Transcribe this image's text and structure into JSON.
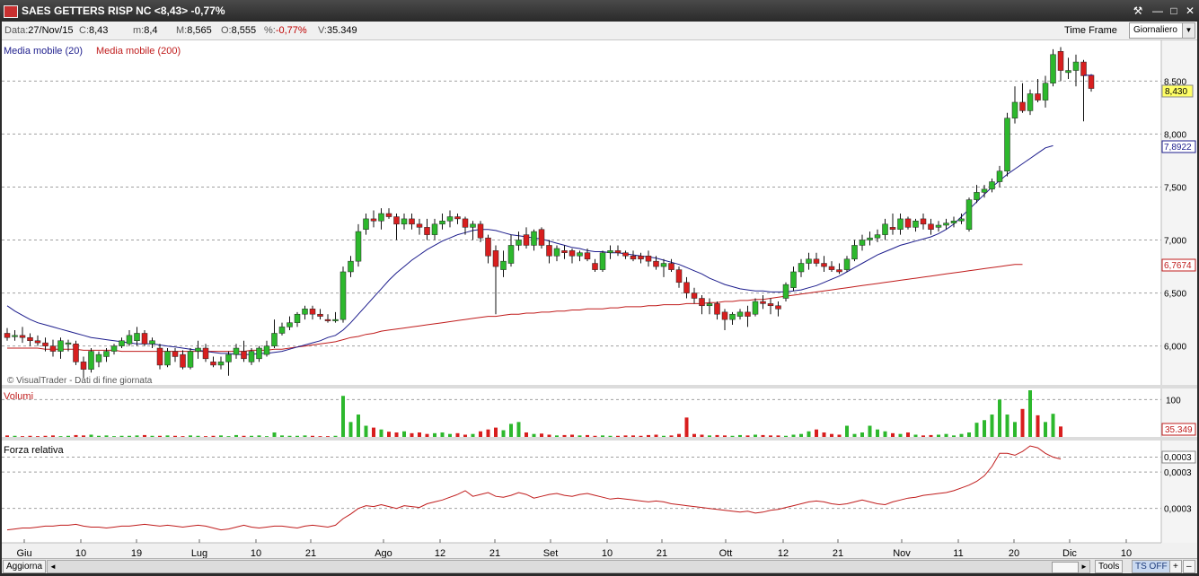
{
  "window": {
    "title": "SAES GETTERS RISP NC <8,43> -0,77%",
    "buttons": [
      "⚒",
      "―",
      "□",
      "✕"
    ]
  },
  "info": {
    "data_label": "Data:",
    "data_value": "27/Nov/15",
    "close_label": "C:",
    "close_value": "8,43",
    "min_label": "m:",
    "min_value": "8,4",
    "max_label": "M:",
    "max_value": "8,565",
    "open_label": "O:",
    "open_value": "8,555",
    "pct_label": "%:",
    "pct_value": "-0,77%",
    "vol_label": "V:",
    "vol_value": "35.349",
    "time_frame_label": "Time Frame",
    "time_frame_value": "Giornaliero"
  },
  "bottom": {
    "refresh_label": "Aggiorna",
    "scroll_left": "◄",
    "scroll_right": "►",
    "tools_label": "Tools",
    "ts_off_label": "TS OFF",
    "plus": "+",
    "minus": "–"
  },
  "colors": {
    "up": "#2db82d",
    "down": "#d81e1e",
    "ma20": "#1c1c8c",
    "ma200": "#c01c1c",
    "grid": "#a0a0a0"
  },
  "chart_data": {
    "type": "candlestick",
    "legend": [
      "Media mobile (20)",
      "Media mobile (200)"
    ],
    "copyright": "© VisualTrader - Dati di fine giornata",
    "volume_label": "Volumi",
    "rs_label": "Forza relativa",
    "x_labels": [
      "Giu",
      "10",
      "19",
      "Lug",
      "10",
      "21",
      "Ago",
      "12",
      "21",
      "Set",
      "10",
      "21",
      "Ott",
      "12",
      "21",
      "Nov",
      "11",
      "20",
      "Dic",
      "10"
    ],
    "price_axis": {
      "ticks": [
        6.0,
        6.5,
        7.0,
        7.5,
        8.0,
        8.5
      ],
      "tick_labels": [
        "6,000",
        "6,500",
        "7,000",
        "7,500",
        "8,000",
        "8,500"
      ],
      "ylim": [
        5.65,
        8.85
      ]
    },
    "price_tags": {
      "last": "8,430",
      "ma20": "7,8922",
      "ma200": "6,7674"
    },
    "volume_axis": {
      "ticks": [
        100
      ],
      "tick_labels": [
        "100"
      ],
      "last_label": "35.349",
      "ylim": [
        0,
        125
      ]
    },
    "rs_axis": {
      "tick_labels": [
        "0,0003",
        "0,0003",
        "0,0003"
      ],
      "last_label": "0,0003"
    },
    "ohlc": [
      [
        6.12,
        6.17,
        6.05,
        6.08
      ],
      [
        6.1,
        6.15,
        6.05,
        6.1
      ],
      [
        6.1,
        6.18,
        6.03,
        6.08
      ],
      [
        6.08,
        6.12,
        6.0,
        6.05
      ],
      [
        6.05,
        6.1,
        6.0,
        6.03
      ],
      [
        6.03,
        6.08,
        5.95,
        6.0
      ],
      [
        6.0,
        6.06,
        5.9,
        5.95
      ],
      [
        5.95,
        6.08,
        5.88,
        6.05
      ],
      [
        6.02,
        6.06,
        5.95,
        6.03
      ],
      [
        6.02,
        6.05,
        5.82,
        5.85
      ],
      [
        5.85,
        5.9,
        5.7,
        5.78
      ],
      [
        5.78,
        5.98,
        5.75,
        5.95
      ],
      [
        5.85,
        5.95,
        5.8,
        5.92
      ],
      [
        5.9,
        5.98,
        5.85,
        5.95
      ],
      [
        5.95,
        6.02,
        5.92,
        6.0
      ],
      [
        6.0,
        6.08,
        5.98,
        6.05
      ],
      [
        6.02,
        6.15,
        6.0,
        6.1
      ],
      [
        6.05,
        6.18,
        6.0,
        6.12
      ],
      [
        6.12,
        6.15,
        6.0,
        6.02
      ],
      [
        6.02,
        6.08,
        5.98,
        6.05
      ],
      [
        5.98,
        6.02,
        5.78,
        5.82
      ],
      [
        5.82,
        5.98,
        5.8,
        5.95
      ],
      [
        5.95,
        5.98,
        5.85,
        5.9
      ],
      [
        5.92,
        5.96,
        5.78,
        5.8
      ],
      [
        5.8,
        5.98,
        5.78,
        5.95
      ],
      [
        5.95,
        6.05,
        5.88,
        5.98
      ],
      [
        5.98,
        6.02,
        5.85,
        5.88
      ],
      [
        5.85,
        5.9,
        5.8,
        5.82
      ],
      [
        5.82,
        5.9,
        5.78,
        5.85
      ],
      [
        5.85,
        5.95,
        5.72,
        5.92
      ],
      [
        5.92,
        6.02,
        5.88,
        5.98
      ],
      [
        5.95,
        6.05,
        5.85,
        5.88
      ],
      [
        5.85,
        5.98,
        5.82,
        5.95
      ],
      [
        5.88,
        6.0,
        5.85,
        5.98
      ],
      [
        5.92,
        6.05,
        5.9,
        6.0
      ],
      [
        6.0,
        6.25,
        5.98,
        6.12
      ],
      [
        6.12,
        6.22,
        6.1,
        6.18
      ],
      [
        6.18,
        6.28,
        6.15,
        6.22
      ],
      [
        6.22,
        6.32,
        6.18,
        6.3
      ],
      [
        6.3,
        6.38,
        6.25,
        6.35
      ],
      [
        6.35,
        6.38,
        6.25,
        6.3
      ],
      [
        6.3,
        6.35,
        6.25,
        6.28
      ],
      [
        6.25,
        6.3,
        6.22,
        6.24
      ],
      [
        6.24,
        6.32,
        6.22,
        6.25
      ],
      [
        6.25,
        6.75,
        6.22,
        6.7
      ],
      [
        6.7,
        6.85,
        6.65,
        6.8
      ],
      [
        6.8,
        7.15,
        6.75,
        7.08
      ],
      [
        7.1,
        7.25,
        7.05,
        7.2
      ],
      [
        7.2,
        7.28,
        7.12,
        7.18
      ],
      [
        7.18,
        7.3,
        7.1,
        7.25
      ],
      [
        7.25,
        7.3,
        7.2,
        7.22
      ],
      [
        7.22,
        7.25,
        7.0,
        7.15
      ],
      [
        7.15,
        7.25,
        7.1,
        7.2
      ],
      [
        7.2,
        7.25,
        7.1,
        7.15
      ],
      [
        7.15,
        7.2,
        7.05,
        7.12
      ],
      [
        7.12,
        7.2,
        7.0,
        7.05
      ],
      [
        7.05,
        7.2,
        7.0,
        7.15
      ],
      [
        7.15,
        7.25,
        7.1,
        7.18
      ],
      [
        7.18,
        7.28,
        7.12,
        7.22
      ],
      [
        7.22,
        7.25,
        7.15,
        7.2
      ],
      [
        7.2,
        7.22,
        7.05,
        7.12
      ],
      [
        7.12,
        7.18,
        7.0,
        7.15
      ],
      [
        7.15,
        7.18,
        6.98,
        7.02
      ],
      [
        7.02,
        7.05,
        6.78,
        6.85
      ],
      [
        6.9,
        6.95,
        6.3,
        6.75
      ],
      [
        6.72,
        6.9,
        6.65,
        6.8
      ],
      [
        6.78,
        7.05,
        6.75,
        6.95
      ],
      [
        6.95,
        7.08,
        6.9,
        7.0
      ],
      [
        7.05,
        7.12,
        6.92,
        6.95
      ],
      [
        6.95,
        7.1,
        6.9,
        7.08
      ],
      [
        7.1,
        7.12,
        6.92,
        6.95
      ],
      [
        6.95,
        7.0,
        6.78,
        6.85
      ],
      [
        6.85,
        6.95,
        6.8,
        6.92
      ],
      [
        6.9,
        6.95,
        6.82,
        6.88
      ],
      [
        6.9,
        6.92,
        6.78,
        6.85
      ],
      [
        6.85,
        6.9,
        6.8,
        6.88
      ],
      [
        6.88,
        6.92,
        6.8,
        6.82
      ],
      [
        6.78,
        6.82,
        6.7,
        6.72
      ],
      [
        6.72,
        6.9,
        6.7,
        6.88
      ],
      [
        6.88,
        6.95,
        6.82,
        6.9
      ],
      [
        6.9,
        6.95,
        6.85,
        6.88
      ],
      [
        6.88,
        6.9,
        6.82,
        6.85
      ],
      [
        6.85,
        6.9,
        6.8,
        6.82
      ],
      [
        6.85,
        6.88,
        6.78,
        6.82
      ],
      [
        6.85,
        6.9,
        6.75,
        6.8
      ],
      [
        6.8,
        6.85,
        6.72,
        6.75
      ],
      [
        6.75,
        6.82,
        6.65,
        6.78
      ],
      [
        6.78,
        6.82,
        6.7,
        6.72
      ],
      [
        6.72,
        6.75,
        6.55,
        6.6
      ],
      [
        6.6,
        6.65,
        6.45,
        6.5
      ],
      [
        6.5,
        6.55,
        6.4,
        6.45
      ],
      [
        6.45,
        6.48,
        6.3,
        6.38
      ],
      [
        6.38,
        6.45,
        6.3,
        6.4
      ],
      [
        6.4,
        6.42,
        6.25,
        6.3
      ],
      [
        6.32,
        6.35,
        6.15,
        6.25
      ],
      [
        6.25,
        6.32,
        6.2,
        6.3
      ],
      [
        6.28,
        6.35,
        6.25,
        6.32
      ],
      [
        6.32,
        6.38,
        6.18,
        6.28
      ],
      [
        6.3,
        6.45,
        6.28,
        6.42
      ],
      [
        6.42,
        6.48,
        6.35,
        6.4
      ],
      [
        6.4,
        6.45,
        6.3,
        6.38
      ],
      [
        6.38,
        6.42,
        6.28,
        6.35
      ],
      [
        6.45,
        6.6,
        6.42,
        6.58
      ],
      [
        6.55,
        6.75,
        6.52,
        6.7
      ],
      [
        6.7,
        6.82,
        6.65,
        6.78
      ],
      [
        6.78,
        6.88,
        6.72,
        6.82
      ],
      [
        6.82,
        6.88,
        6.75,
        6.78
      ],
      [
        6.78,
        6.85,
        6.7,
        6.75
      ],
      [
        6.75,
        6.8,
        6.7,
        6.72
      ],
      [
        6.72,
        6.78,
        6.68,
        6.7
      ],
      [
        6.72,
        6.85,
        6.7,
        6.82
      ],
      [
        6.82,
        7.0,
        6.8,
        6.95
      ],
      [
        6.95,
        7.05,
        6.9,
        7.0
      ],
      [
        7.0,
        7.08,
        6.95,
        7.02
      ],
      [
        7.02,
        7.1,
        6.98,
        7.05
      ],
      [
        7.05,
        7.2,
        7.0,
        7.15
      ],
      [
        7.12,
        7.25,
        7.05,
        7.1
      ],
      [
        7.1,
        7.25,
        7.05,
        7.2
      ],
      [
        7.2,
        7.22,
        7.1,
        7.12
      ],
      [
        7.12,
        7.2,
        7.08,
        7.18
      ],
      [
        7.2,
        7.25,
        7.1,
        7.15
      ],
      [
        7.15,
        7.2,
        7.05,
        7.1
      ],
      [
        7.12,
        7.18,
        7.08,
        7.14
      ],
      [
        7.14,
        7.2,
        7.1,
        7.16
      ],
      [
        7.16,
        7.22,
        7.12,
        7.18
      ],
      [
        7.18,
        7.25,
        7.15,
        7.2
      ],
      [
        7.1,
        7.4,
        7.08,
        7.38
      ],
      [
        7.38,
        7.52,
        7.35,
        7.45
      ],
      [
        7.45,
        7.52,
        7.4,
        7.48
      ],
      [
        7.48,
        7.58,
        7.45,
        7.55
      ],
      [
        7.55,
        7.7,
        7.5,
        7.65
      ],
      [
        7.65,
        8.2,
        7.6,
        8.15
      ],
      [
        8.15,
        8.45,
        8.1,
        8.3
      ],
      [
        8.3,
        8.48,
        8.2,
        8.22
      ],
      [
        8.22,
        8.42,
        8.18,
        8.38
      ],
      [
        8.38,
        8.52,
        8.3,
        8.32
      ],
      [
        8.32,
        8.55,
        8.25,
        8.48
      ],
      [
        8.48,
        8.8,
        8.45,
        8.75
      ],
      [
        8.78,
        8.82,
        8.5,
        8.6
      ],
      [
        8.58,
        8.72,
        8.52,
        8.6
      ],
      [
        8.6,
        8.75,
        8.45,
        8.68
      ],
      [
        8.68,
        8.7,
        8.12,
        8.55
      ],
      [
        8.555,
        8.565,
        8.4,
        8.43
      ]
    ],
    "ma20": [
      6.38,
      6.33,
      6.29,
      6.25,
      6.22,
      6.2,
      6.18,
      6.16,
      6.14,
      6.12,
      6.1,
      6.08,
      6.07,
      6.06,
      6.05,
      6.04,
      6.03,
      6.02,
      6.02,
      6.02,
      6.01,
      6.0,
      5.99,
      5.98,
      5.97,
      5.96,
      5.95,
      5.94,
      5.93,
      5.93,
      5.92,
      5.92,
      5.92,
      5.93,
      5.93,
      5.94,
      5.95,
      5.97,
      5.99,
      6.01,
      6.03,
      6.05,
      6.08,
      6.1,
      6.15,
      6.22,
      6.3,
      6.38,
      6.46,
      6.54,
      6.62,
      6.69,
      6.75,
      6.81,
      6.86,
      6.91,
      6.95,
      6.99,
      7.02,
      7.05,
      7.07,
      7.09,
      7.1,
      7.1,
      7.09,
      7.07,
      7.05,
      7.04,
      7.03,
      7.02,
      7.01,
      6.99,
      6.97,
      6.95,
      6.93,
      6.92,
      6.9,
      6.89,
      6.89,
      6.88,
      6.88,
      6.87,
      6.86,
      6.85,
      6.84,
      6.83,
      6.81,
      6.79,
      6.77,
      6.74,
      6.71,
      6.68,
      6.64,
      6.61,
      6.58,
      6.56,
      6.54,
      6.53,
      6.52,
      6.52,
      6.51,
      6.51,
      6.51,
      6.52,
      6.53,
      6.55,
      6.57,
      6.6,
      6.63,
      6.66,
      6.7,
      6.74,
      6.78,
      6.82,
      6.86,
      6.89,
      6.92,
      6.95,
      6.97,
      6.99,
      7.01,
      7.03,
      7.06,
      7.1,
      7.15,
      7.22,
      7.29,
      7.36,
      7.43,
      7.5,
      7.56,
      7.62,
      7.67,
      7.72,
      7.77,
      7.82,
      7.87,
      7.89
    ],
    "ma200": [
      5.98,
      5.98,
      5.98,
      5.98,
      5.98,
      5.97,
      5.97,
      5.97,
      5.97,
      5.97,
      5.96,
      5.96,
      5.96,
      5.96,
      5.96,
      5.95,
      5.95,
      5.95,
      5.95,
      5.95,
      5.95,
      5.95,
      5.95,
      5.95,
      5.95,
      5.95,
      5.95,
      5.95,
      5.95,
      5.95,
      5.95,
      5.95,
      5.96,
      5.96,
      5.96,
      5.97,
      5.97,
      5.98,
      5.99,
      6.0,
      6.01,
      6.02,
      6.03,
      6.04,
      6.06,
      6.08,
      6.09,
      6.11,
      6.12,
      6.14,
      6.15,
      6.16,
      6.17,
      6.18,
      6.19,
      6.2,
      6.21,
      6.22,
      6.23,
      6.24,
      6.25,
      6.26,
      6.27,
      6.28,
      6.28,
      6.29,
      6.3,
      6.3,
      6.31,
      6.31,
      6.32,
      6.32,
      6.33,
      6.33,
      6.34,
      6.34,
      6.35,
      6.35,
      6.35,
      6.36,
      6.36,
      6.37,
      6.37,
      6.37,
      6.38,
      6.38,
      6.39,
      6.39,
      6.39,
      6.4,
      6.4,
      6.4,
      6.41,
      6.41,
      6.42,
      6.42,
      6.43,
      6.43,
      6.44,
      6.44,
      6.45,
      6.46,
      6.47,
      6.48,
      6.49,
      6.5,
      6.51,
      6.52,
      6.53,
      6.54,
      6.55,
      6.56,
      6.57,
      6.58,
      6.59,
      6.6,
      6.61,
      6.62,
      6.63,
      6.64,
      6.65,
      6.66,
      6.67,
      6.68,
      6.69,
      6.7,
      6.71,
      6.72,
      6.73,
      6.74,
      6.75,
      6.76,
      6.77,
      6.77
    ],
    "volume": [
      4,
      3,
      2,
      3,
      2,
      3,
      4,
      2,
      3,
      5,
      4,
      6,
      3,
      4,
      2,
      3,
      3,
      4,
      5,
      3,
      3,
      4,
      3,
      2,
      4,
      3,
      2,
      3,
      4,
      2,
      5,
      3,
      3,
      4,
      2,
      12,
      4,
      3,
      3,
      4,
      3,
      2,
      2,
      3,
      110,
      40,
      60,
      30,
      25,
      20,
      14,
      12,
      15,
      10,
      12,
      8,
      10,
      12,
      8,
      10,
      6,
      8,
      15,
      20,
      25,
      18,
      35,
      40,
      12,
      8,
      9,
      6,
      4,
      5,
      6,
      4,
      5,
      3,
      4,
      3,
      3,
      4,
      4,
      3,
      5,
      6,
      3,
      4,
      8,
      52,
      8,
      6,
      4,
      5,
      4,
      3,
      5,
      4,
      6,
      5,
      4,
      4,
      3,
      6,
      8,
      15,
      20,
      12,
      8,
      6,
      30,
      8,
      12,
      30,
      20,
      15,
      10,
      8,
      12,
      6,
      4,
      5,
      6,
      8,
      4,
      8,
      12,
      38,
      45,
      60,
      100,
      60,
      40,
      75,
      125,
      58,
      40,
      62,
      28
    ],
    "rs": [
      0.1,
      0.11,
      0.12,
      0.12,
      0.13,
      0.14,
      0.14,
      0.15,
      0.15,
      0.16,
      0.14,
      0.13,
      0.13,
      0.12,
      0.13,
      0.14,
      0.14,
      0.15,
      0.16,
      0.15,
      0.14,
      0.15,
      0.14,
      0.13,
      0.14,
      0.15,
      0.14,
      0.12,
      0.1,
      0.11,
      0.13,
      0.15,
      0.13,
      0.12,
      0.13,
      0.14,
      0.14,
      0.13,
      0.12,
      0.14,
      0.15,
      0.14,
      0.13,
      0.15,
      0.22,
      0.27,
      0.33,
      0.36,
      0.35,
      0.37,
      0.35,
      0.33,
      0.36,
      0.35,
      0.34,
      0.38,
      0.4,
      0.42,
      0.45,
      0.48,
      0.52,
      0.46,
      0.48,
      0.5,
      0.46,
      0.45,
      0.47,
      0.5,
      0.48,
      0.44,
      0.46,
      0.48,
      0.49,
      0.47,
      0.46,
      0.48,
      0.49,
      0.47,
      0.45,
      0.43,
      0.44,
      0.43,
      0.42,
      0.41,
      0.4,
      0.41,
      0.4,
      0.38,
      0.37,
      0.36,
      0.35,
      0.34,
      0.33,
      0.32,
      0.31,
      0.3,
      0.29,
      0.3,
      0.28,
      0.29,
      0.31,
      0.32,
      0.34,
      0.36,
      0.38,
      0.4,
      0.41,
      0.4,
      0.38,
      0.37,
      0.38,
      0.4,
      0.42,
      0.4,
      0.38,
      0.37,
      0.4,
      0.42,
      0.44,
      0.45,
      0.47,
      0.48,
      0.49,
      0.5,
      0.52,
      0.55,
      0.58,
      0.62,
      0.68,
      0.78,
      0.92,
      0.92,
      0.9,
      0.94,
      1.0,
      0.98,
      0.92,
      0.88,
      0.86
    ]
  }
}
